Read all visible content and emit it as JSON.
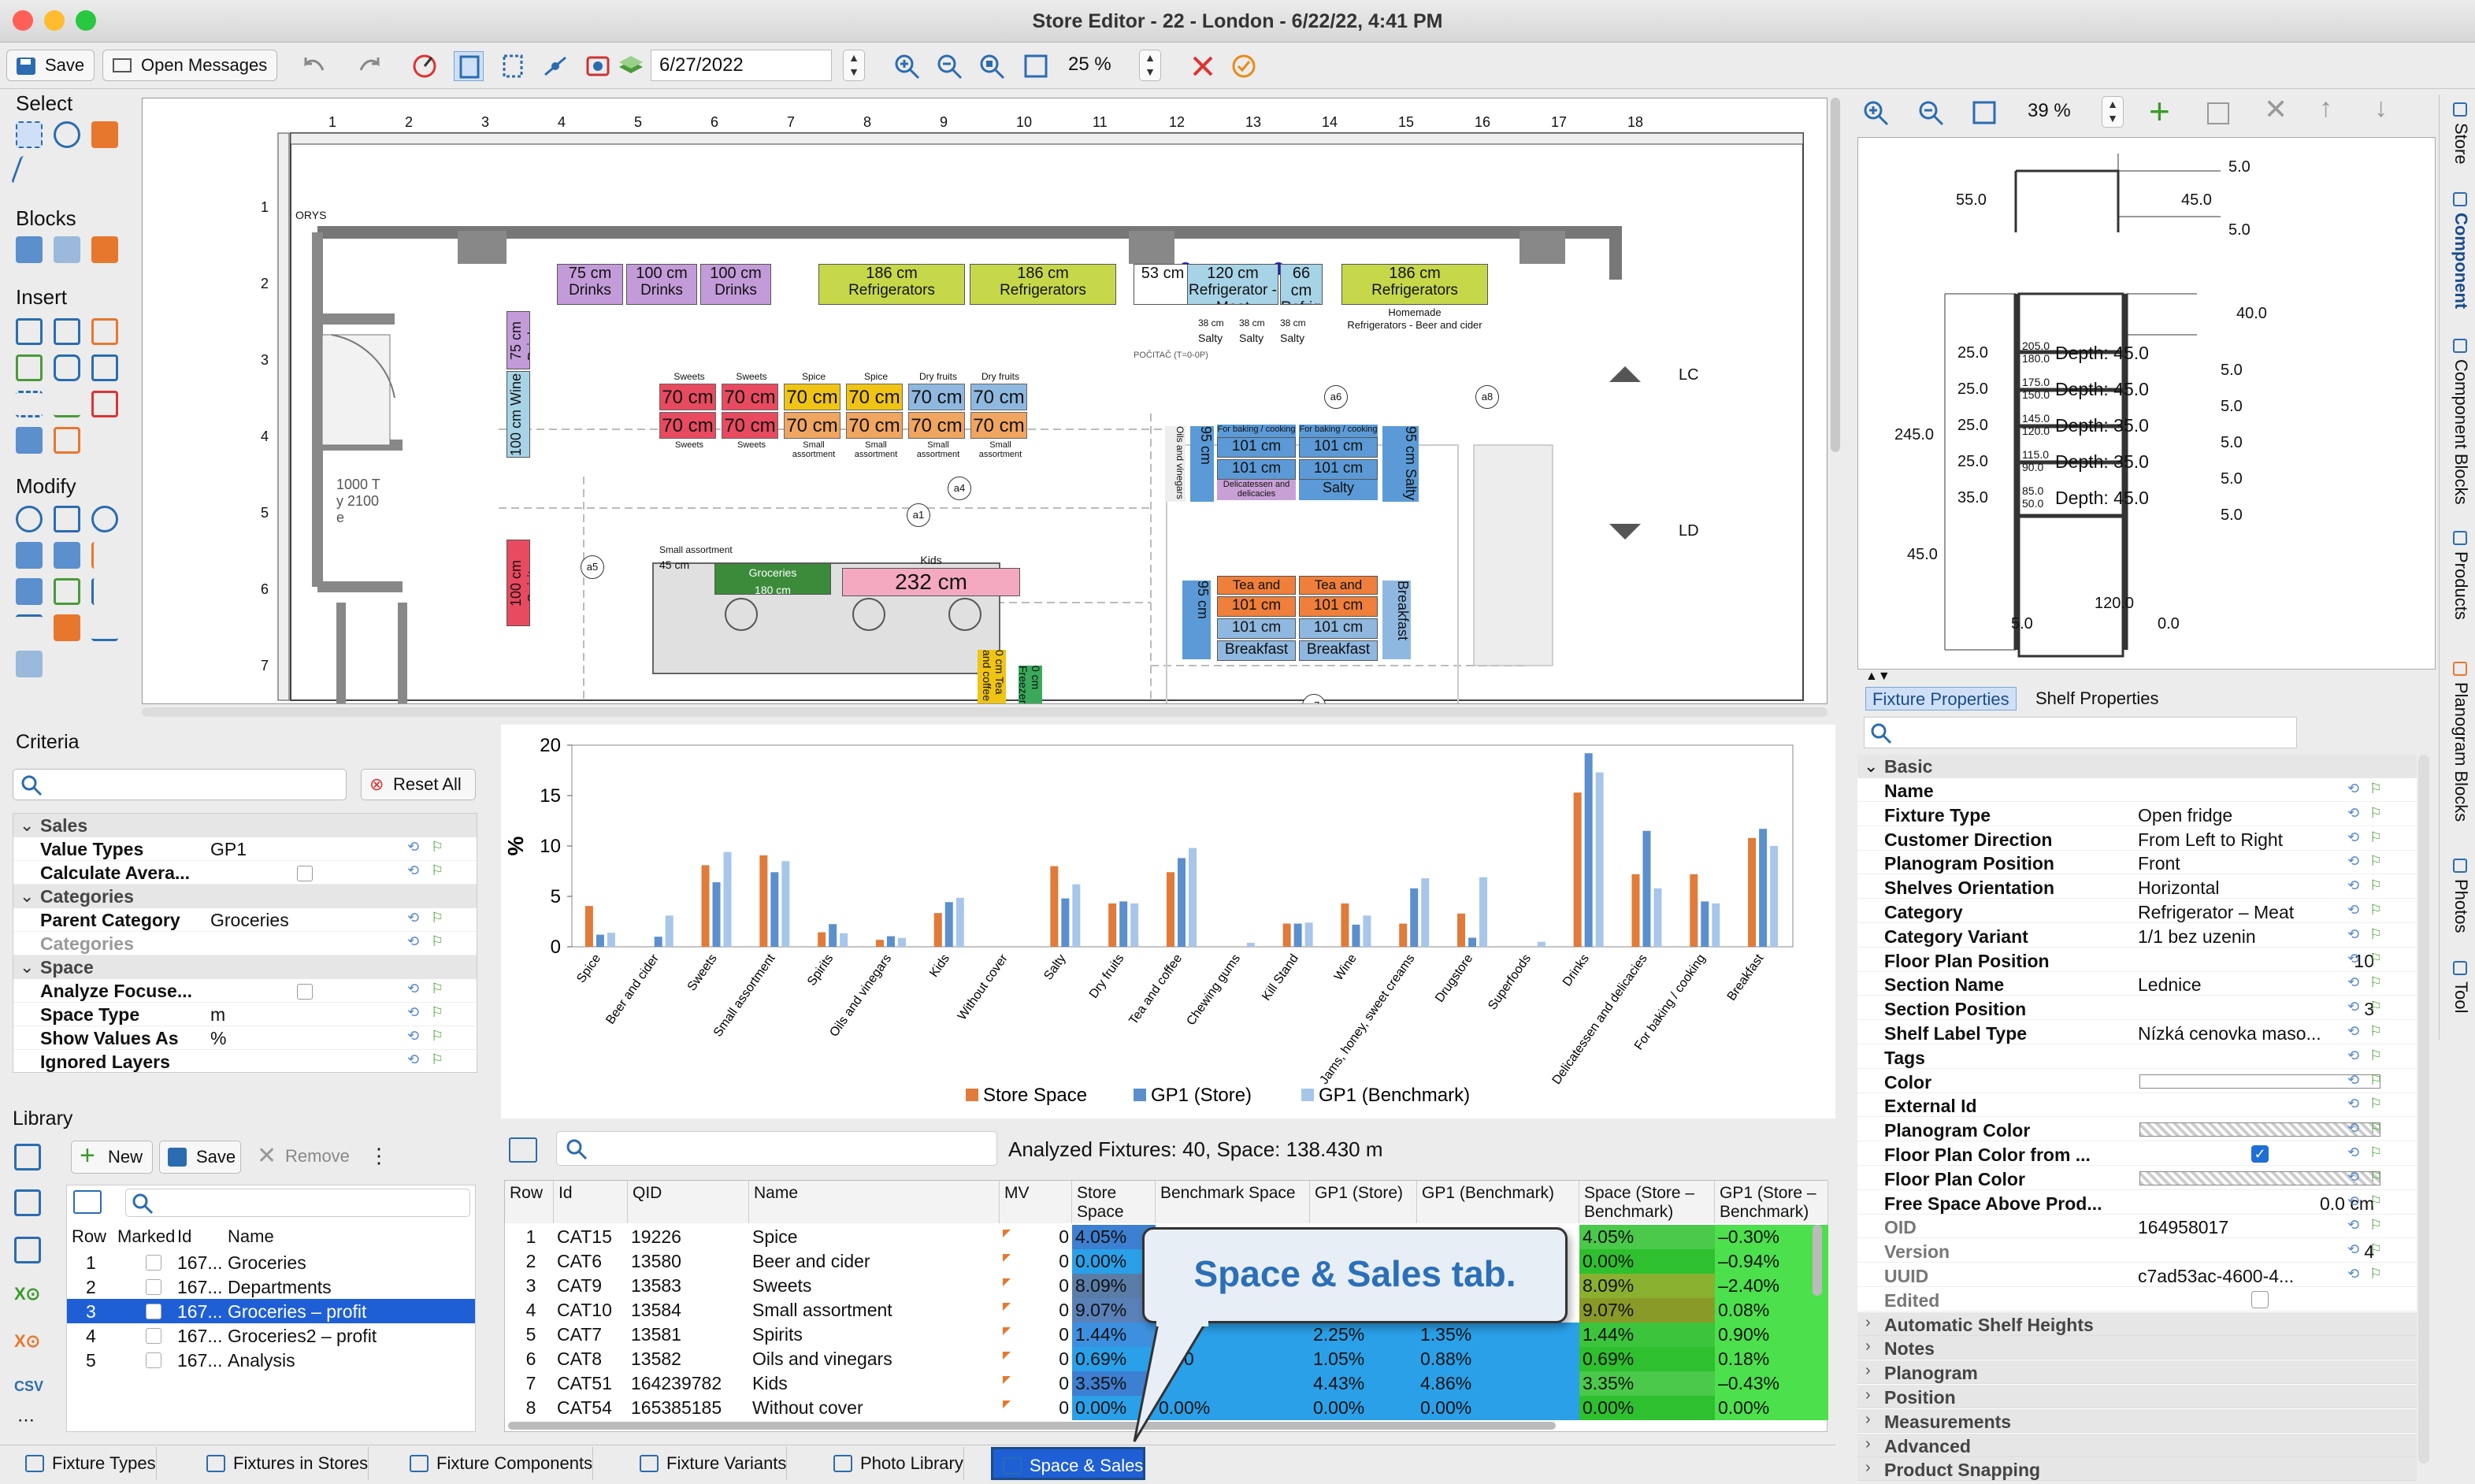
{
  "window": {
    "title": "Store Editor - 22 - London - 6/22/22, 4:41 PM"
  },
  "toolbar": {
    "save": "Save",
    "open_messages": "Open Messages",
    "date": "6/27/2022",
    "zoom": "25 %"
  },
  "left_tools": {
    "select": "Select",
    "blocks": "Blocks",
    "insert": "Insert",
    "modify": "Modify"
  },
  "ruler": {
    "marks": [
      "1",
      "2",
      "3",
      "4",
      "5",
      "6",
      "7",
      "8",
      "9",
      "10",
      "11",
      "12",
      "13",
      "14",
      "15",
      "16",
      "17",
      "18"
    ],
    "vmarks": [
      "1",
      "2",
      "3",
      "4",
      "5",
      "6",
      "7"
    ]
  },
  "floor": {
    "top": [
      {
        "l": "75 cm",
        "s": "Drinks"
      },
      {
        "l": "100 cm",
        "s": "Drinks"
      },
      {
        "l": "100 cm",
        "s": "Drinks"
      },
      {
        "l": "186 cm",
        "s": "Refrigerators"
      },
      {
        "l": "186 cm",
        "s": "Refrigerators"
      },
      {
        "l": "53 cm",
        "s": ""
      },
      {
        "l": "120 cm",
        "s": "Refrigerator - Meat"
      },
      {
        "l": "66 cm",
        "s": "Refrigerators"
      },
      {
        "l": "186 cm",
        "s": "Refrigerators"
      }
    ],
    "homemade": "Homemade",
    "homemade2": "Refrigerators - Beer and cider",
    "salty": [
      "38 cm",
      "38 cm",
      "38 cm"
    ],
    "salty_labels": [
      "Salty",
      "Salty",
      "Salty"
    ],
    "left_wall": [
      {
        "l": "75 cm",
        "s": "Drinks"
      },
      {
        "l": "100 cm",
        "s": "Wine"
      },
      {
        "l": "100 cm",
        "s": "Spirits"
      }
    ],
    "island_top": [
      "Sweets",
      "Sweets",
      "Spice",
      "Spice",
      "Dry fruits",
      "Dry fruits"
    ],
    "island_row1": [
      "70 cm",
      "70 cm",
      "70 cm",
      "70 cm",
      "70 cm",
      "70 cm"
    ],
    "island_row2": [
      "70 cm",
      "70 cm",
      "70 cm",
      "70 cm",
      "70 cm",
      "70 cm"
    ],
    "island_bottom": [
      "Sweets",
      "Sweets",
      "Small assortment",
      "Small assortment",
      "Small assortment",
      "Small assortment"
    ],
    "baking1": [
      "For baking / cooking",
      "For baking / cooking"
    ],
    "b101a": [
      "101 cm",
      "101 cm"
    ],
    "b101b": [
      "101 cm",
      "101 cm"
    ],
    "deli": "Delicatessen and delicacies",
    "salty2": "Salty",
    "oils": "Oils and vinegars",
    "nine": "95 cm",
    "salty3": "Salty",
    "tea": [
      "Tea and coffee",
      "Tea and coffee"
    ],
    "t101a": [
      "101 cm",
      "101 cm"
    ],
    "t101b": [
      "101 cm",
      "101 cm"
    ],
    "breakfast": [
      "Breakfast",
      "Breakfast"
    ],
    "nine2": "95 cm",
    "breakfast2": "Breakfast",
    "groceries": "Groceries",
    "groceries_l": "180 cm",
    "kids": "Kids",
    "kids_l": "232 cm",
    "small": "45 cm",
    "small2": "Small assortment",
    "markers": [
      "a1",
      "a4",
      "a5",
      "a6",
      "a8",
      "a7"
    ],
    "door_text": "1000 Ty 2100 e",
    "po": "POČITAČ (T=0-0P)",
    "ors": "ORYS",
    "bottom": [
      "0 cm",
      "0 cm"
    ],
    "vertical": [
      "Tea and coffee",
      "Freezer"
    ],
    "lc": "LC",
    "ld": "LD"
  },
  "criteria": {
    "title": "Criteria",
    "reset": "Reset All",
    "rows": [
      {
        "t": "group",
        "k": "Sales"
      },
      {
        "t": "row",
        "k": "Value Types",
        "v": "GP1"
      },
      {
        "t": "row",
        "k": "Calculate Avera...",
        "v": "",
        "check": true
      },
      {
        "t": "group",
        "k": "Categories"
      },
      {
        "t": "row",
        "k": "Parent Category",
        "v": "Groceries"
      },
      {
        "t": "dim",
        "k": "Categories",
        "v": ""
      },
      {
        "t": "group",
        "k": "Space"
      },
      {
        "t": "row",
        "k": "Analyze Focuse...",
        "v": "",
        "check": true
      },
      {
        "t": "row",
        "k": "Space Type",
        "v": "m"
      },
      {
        "t": "row",
        "k": "Show Values As",
        "v": "%"
      },
      {
        "t": "row",
        "k": "Ignored Layers",
        "v": ""
      }
    ]
  },
  "library": {
    "title": "Library",
    "new": "New",
    "save": "Save",
    "remove": "Remove",
    "headers": [
      "Row",
      "Marked",
      "Id",
      "Name"
    ],
    "rows": [
      {
        "r": "1",
        "id": "167...",
        "n": "Groceries"
      },
      {
        "r": "2",
        "id": "167...",
        "n": "Departments"
      },
      {
        "r": "3",
        "id": "167...",
        "n": "Groceries – profit"
      },
      {
        "r": "4",
        "id": "167...",
        "n": "Groceries2 – profit"
      },
      {
        "r": "5",
        "id": "167...",
        "n": "Analysis"
      }
    ]
  },
  "chart_data": {
    "type": "bar",
    "xlabel": "",
    "ylabel": "%",
    "ylim": [
      0,
      20
    ],
    "yticks": [
      0,
      5,
      10,
      15,
      20
    ],
    "legend": "bottom",
    "categories": [
      "Spice",
      "Beer and cider",
      "Sweets",
      "Small assortment",
      "Spirits",
      "Oils and vinegars",
      "Kids",
      "Without cover",
      "Salty",
      "Dry fruits",
      "Tea and coffee",
      "Chewing gums",
      "Kill Stand",
      "Wine",
      "Jams, honey, sweet creams",
      "Drugstore",
      "Superfoods",
      "Drinks",
      "Delicatessen and delicacies",
      "For baking / cooking",
      "Breakfast"
    ],
    "series": [
      {
        "name": "Store Space",
        "color": "#e07b39",
        "values": [
          4.05,
          0,
          8.09,
          9.07,
          1.44,
          0.69,
          3.35,
          0,
          8,
          4.3,
          7.4,
          0,
          2.3,
          4.3,
          2.3,
          3.3,
          0,
          15.3,
          7.2,
          7.2,
          10.8
        ]
      },
      {
        "name": "GP1 (Store)",
        "color": "#5b8fce",
        "values": [
          1.2,
          1,
          6.4,
          7.4,
          2.25,
          1.05,
          4.43,
          0,
          4.8,
          4.5,
          8.8,
          0,
          2.3,
          2.2,
          5.8,
          0.9,
          0,
          19.2,
          11.5,
          4.5,
          11.7
        ]
      },
      {
        "name": "GP1 (Benchmark)",
        "color": "#a7c6ea",
        "values": [
          1.4,
          3.1,
          9.4,
          8.5,
          1.35,
          0.88,
          4.86,
          0,
          6.2,
          4.3,
          9.8,
          0.4,
          2.4,
          3.1,
          6.8,
          6.9,
          0.5,
          17.3,
          5.8,
          4.3,
          10
        ]
      }
    ]
  },
  "table": {
    "summary": "Analyzed Fixtures: 40, Space: 138.430 m",
    "headers": [
      "Row",
      "Id",
      "QID",
      "Name",
      "MV",
      "Store Space",
      "Benchmark Space",
      "GP1 (Store)",
      "GP1 (Benchmark)",
      "Space (Store – Benchmark)",
      "GP1 (Store – Benchmark)"
    ],
    "rows": [
      {
        "r": "1",
        "id": "CAT15",
        "qid": "19226",
        "n": "Spice",
        "mv": "0",
        "ss": "4.05%",
        "bs": "",
        "gs": "",
        "gb": "",
        "sd": "4.05%",
        "gd": "–0.30%"
      },
      {
        "r": "2",
        "id": "CAT6",
        "qid": "13580",
        "n": "Beer and cider",
        "mv": "0",
        "ss": "0.00%",
        "bs": "",
        "gs": "",
        "gb": "",
        "sd": "0.00%",
        "gd": "–0.94%"
      },
      {
        "r": "3",
        "id": "CAT9",
        "qid": "13583",
        "n": "Sweets",
        "mv": "0",
        "ss": "8.09%",
        "bs": "",
        "gs": "",
        "gb": "",
        "sd": "8.09%",
        "gd": "–2.40%"
      },
      {
        "r": "4",
        "id": "CAT10",
        "qid": "13584",
        "n": "Small assortment",
        "mv": "0",
        "ss": "9.07%",
        "bs": "",
        "gs": "",
        "gb": "",
        "sd": "9.07%",
        "gd": "0.08%"
      },
      {
        "r": "5",
        "id": "CAT7",
        "qid": "13581",
        "n": "Spirits",
        "mv": "0",
        "ss": "1.44%",
        "bs": "",
        "gs": "2.25%",
        "gb": "1.35%",
        "sd": "1.44%",
        "gd": "0.90%"
      },
      {
        "r": "6",
        "id": "CAT8",
        "qid": "13582",
        "n": "Oils and vinegars",
        "mv": "0",
        "ss": "0.69%",
        "bs": "0.00",
        "gs": "1.05%",
        "gb": "0.88%",
        "sd": "0.69%",
        "gd": "0.18%"
      },
      {
        "r": "7",
        "id": "CAT51",
        "qid": "164239782",
        "n": "Kids",
        "mv": "0",
        "ss": "3.35%",
        "bs": "",
        "gs": "4.43%",
        "gb": "4.86%",
        "sd": "3.35%",
        "gd": "–0.43%"
      },
      {
        "r": "8",
        "id": "CAT54",
        "qid": "165385185",
        "n": "Without cover",
        "mv": "0",
        "ss": "0.00%",
        "bs": "0.00%",
        "gs": "0.00%",
        "gb": "0.00%",
        "sd": "0.00%",
        "gd": "0.00%"
      }
    ]
  },
  "callout": "Space & Sales tab.",
  "bottom_tabs": [
    "Fixture Types",
    "Fixtures in Stores",
    "Fixture Components",
    "Fixture Variants",
    "Photo Library",
    "Space & Sales"
  ],
  "right_toolbar": {
    "zoom": "39 %"
  },
  "drawing": {
    "top_dims": [
      "5.0",
      "55.0",
      "45.0",
      "5.0"
    ],
    "w40": "40.0",
    "left_dims": [
      "25.0",
      "25.0",
      "25.0",
      "25.0",
      "35.0"
    ],
    "h245": "245.0",
    "w45": "45.0",
    "shelves": [
      {
        "a": "205.0",
        "b": "180.0",
        "d": "Depth: 45.0"
      },
      {
        "a": "175.0",
        "b": "150.0",
        "d": "Depth: 45.0"
      },
      {
        "a": "145.0",
        "b": "120.0",
        "d": "Depth: 35.0"
      },
      {
        "a": "115.0",
        "b": "90.0",
        "d": "Depth: 35.0"
      },
      {
        "a": "85.0",
        "b": "50.0",
        "d": "Depth: 45.0"
      }
    ],
    "right_dims": [
      "5.0",
      "5.0",
      "5.0",
      "5.0",
      "5.0"
    ],
    "bottom": [
      "5.0",
      "120.0",
      "0.0"
    ]
  },
  "props": {
    "tab1": "Fixture Properties",
    "tab2": "Shelf Properties",
    "basic": "Basic",
    "rows": [
      {
        "k": "Name",
        "v": ""
      },
      {
        "k": "Fixture Type",
        "v": "Open fridge"
      },
      {
        "k": "Customer Direction",
        "v": "From Left to Right"
      },
      {
        "k": "Planogram Position",
        "v": "Front"
      },
      {
        "k": "Shelves Orientation",
        "v": "Horizontal"
      },
      {
        "k": "Category",
        "v": "Refrigerator – Meat"
      },
      {
        "k": "Category Variant",
        "v": "1/1 bez uzenin"
      },
      {
        "k": "Floor Plan Position",
        "v": "10",
        "num": true
      },
      {
        "k": "Section Name",
        "v": "Lednice"
      },
      {
        "k": "Section Position",
        "v": "3",
        "num": true
      },
      {
        "k": "Shelf Label Type",
        "v": "Nízká cenovka maso..."
      },
      {
        "k": "Tags",
        "v": ""
      },
      {
        "k": "Color",
        "v": "",
        "swatch": "white"
      },
      {
        "k": "External Id",
        "v": ""
      },
      {
        "k": "Planogram Color",
        "v": "",
        "swatch": "checker"
      },
      {
        "k": "Floor Plan Color from ...",
        "v": "",
        "swatch": "check"
      },
      {
        "k": "Floor Plan Color",
        "v": "",
        "swatch": "checker"
      },
      {
        "k": "Free Space Above Prod...",
        "v": "0.0 cm",
        "num": true
      },
      {
        "k": "OID",
        "v": "164958017",
        "dim": true
      },
      {
        "k": "Version",
        "v": "4",
        "dim": true,
        "num": true
      },
      {
        "k": "UUID",
        "v": "c7ad53ac-4600-4...",
        "dim": true
      },
      {
        "k": "Edited",
        "v": "",
        "dim": true
      }
    ],
    "groups": [
      "Automatic Shelf Heights",
      "Notes",
      "Planogram",
      "Position",
      "Measurements",
      "Advanced",
      "Product Snapping"
    ]
  },
  "side_tabs": [
    "Store",
    "Component",
    "Component Blocks",
    "Products",
    "Planogram Blocks",
    "Photos",
    "Tool"
  ]
}
